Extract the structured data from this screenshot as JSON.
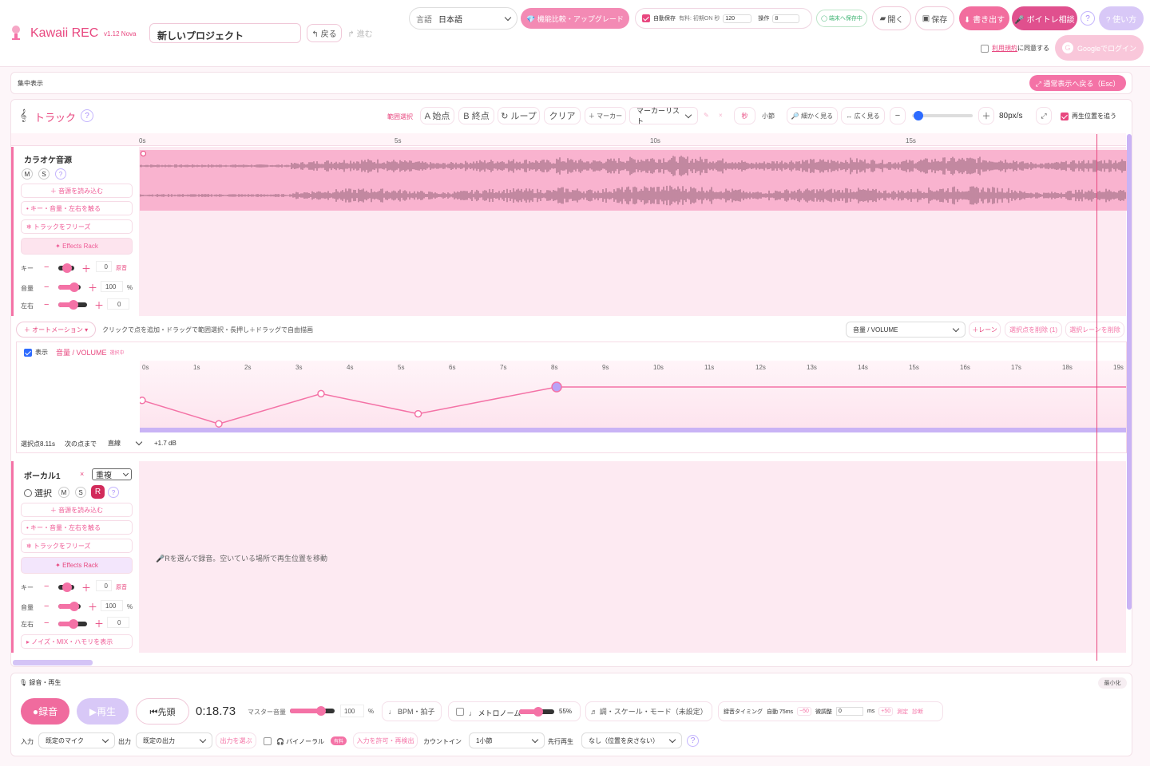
{
  "header": {
    "app_name": "Kawaii REC",
    "version": "v1.12 Nova",
    "project_name": "新しいプロジェクト",
    "undo": "↰ 戻る",
    "redo": "↱ 進む",
    "language_label": "言語",
    "language_value": "日本語",
    "upgrade": "💎 機能比較・アップグレード",
    "autosave_label": "自動保存",
    "autosave_detail": "有料: 初期ON 秒",
    "autosave_seconds": "120",
    "ops_label": "操作",
    "ops_value": "8",
    "device_save": "◯ 端末へ保存中",
    "open": "開く",
    "save": "保存",
    "export": "⬇ 書き出す",
    "voice_consult": "🎤 ボイトレ相談",
    "help": "?",
    "howto": "? 使い方",
    "terms_link": "利用規約",
    "terms_suffix": "に同意する",
    "google_login": "Googleでログイン"
  },
  "focus": {
    "label": "集中表示",
    "back_button": "⤢ 通常表示へ戻る（Esc）"
  },
  "track_toolbar": {
    "title": "トラック",
    "range_select": "範囲選択",
    "a_start": "A 始点",
    "b_end": "B 終点",
    "loop": "↻ ループ",
    "clear": "クリア",
    "add_marker": "＋ マーカー",
    "marker_list": "マーカーリスト",
    "sec": "秒",
    "bar": "小節",
    "zoom_in": "🔎 細かく見る",
    "zoom_out": "↔ 広く見る",
    "minus": "−",
    "plus": "＋",
    "zoom_value": "80px/s",
    "follow_playhead": "再生位置を追う",
    "zoom_fraction": 0.03
  },
  "ruler": [
    "0s",
    "5s",
    "10s",
    "15s"
  ],
  "karaoke": {
    "name": "カラオケ音源",
    "mute": "M",
    "solo": "S",
    "help": "?",
    "load": "＋ 音源を読み込む",
    "key_vol": "• キー・音量・左右を触る",
    "freeze": "❄ トラックをフリーズ",
    "effects": "✦ Effects Rack",
    "key_label": "キー",
    "key_value": "0",
    "key_unit": "原音",
    "vol_label": "音量",
    "vol_value": "100",
    "vol_unit": "%",
    "pan_label": "左右",
    "pan_value": "0",
    "minus": "−",
    "plus": "＋"
  },
  "automation": {
    "button": "＋ オートメーション ▾",
    "hint": "クリックで点を追加・ドラッグで範囲選択・長押し＋ドラッグで自由描画",
    "lane_select": "音量 / VOLUME",
    "add_lane": "＋レーン",
    "delete_points": "選択点を削除 (1)",
    "delete_lane": "選択レーンを削除",
    "show": "表示",
    "lane_name": "音量 / VOLUME",
    "selecting": "選択中",
    "ruler": [
      "0s",
      "1s",
      "2s",
      "3s",
      "4s",
      "5s",
      "6s",
      "7s",
      "8s",
      "9s",
      "10s",
      "11s",
      "12s",
      "13s",
      "14s",
      "15s",
      "16s",
      "17s",
      "18s",
      "19s"
    ],
    "points": [
      {
        "t": 0,
        "v": 0.55
      },
      {
        "t": 1.5,
        "v": 0.2
      },
      {
        "t": 3.5,
        "v": 0.65
      },
      {
        "t": 5.4,
        "v": 0.35
      },
      {
        "t": 8.11,
        "v": 0.75
      }
    ],
    "footer_selected": "選択点8.11s",
    "footer_next": "次の点まで",
    "curve_type": "直線",
    "db_value": "+1.7 dB"
  },
  "vocal": {
    "name": "ボーカル1",
    "close": "×",
    "mode": "重複",
    "select": "選択",
    "mute": "M",
    "solo": "S",
    "record": "R",
    "help": "?",
    "load": "＋ 音源を読み込む",
    "key_vol": "• キー・音量・左右を触る",
    "freeze": "❄ トラックをフリーズ",
    "effects": "✦ Effects Rack",
    "key_label": "キー",
    "key_value": "0",
    "key_unit": "原音",
    "vol_label": "音量",
    "vol_value": "100",
    "vol_unit": "%",
    "pan_label": "左右",
    "pan_value": "0",
    "noise": "▸ ノイズ・MIX・ハモリを表示",
    "empty_hint": "🎤Rを選んで録音。空いている場所で再生位置を移動",
    "minus": "−",
    "plus": "＋"
  },
  "transport": {
    "section": "🎙 録音・再生",
    "minimize": "最小化",
    "record": "●録音",
    "play": "▶再生",
    "to_start": "⏮先頭",
    "time": "0:18.73",
    "master_label": "マスター音量",
    "master_value": "100",
    "master_unit": "%",
    "bpm": "♩ BPM・拍子",
    "metronome": "♩ メトロノーム",
    "metronome_value": "55%",
    "key_scale": "♬ 調・スケール・モード（未設定）",
    "rec_timing": "録音タイミング",
    "auto": "自動 75ms",
    "minus50": "−50",
    "fine": "微調整",
    "fine_value": "0",
    "ms": "ms",
    "plus50": "+50",
    "measure": "測定",
    "diagnose": "診断",
    "input_label": "入力",
    "input_value": "既定のマイク",
    "output_label": "出力",
    "output_value": "既定の出力",
    "choose_output": "出力を選ぶ",
    "binaural": "🎧 バイノーラル",
    "paid": "有料",
    "allow_input": "入力を許可・再検出",
    "countin_label": "カウントイン",
    "countin_value": "1小節",
    "preroll_label": "先行再生",
    "preroll_value": "なし（位置を戻さない）",
    "help": "?"
  }
}
